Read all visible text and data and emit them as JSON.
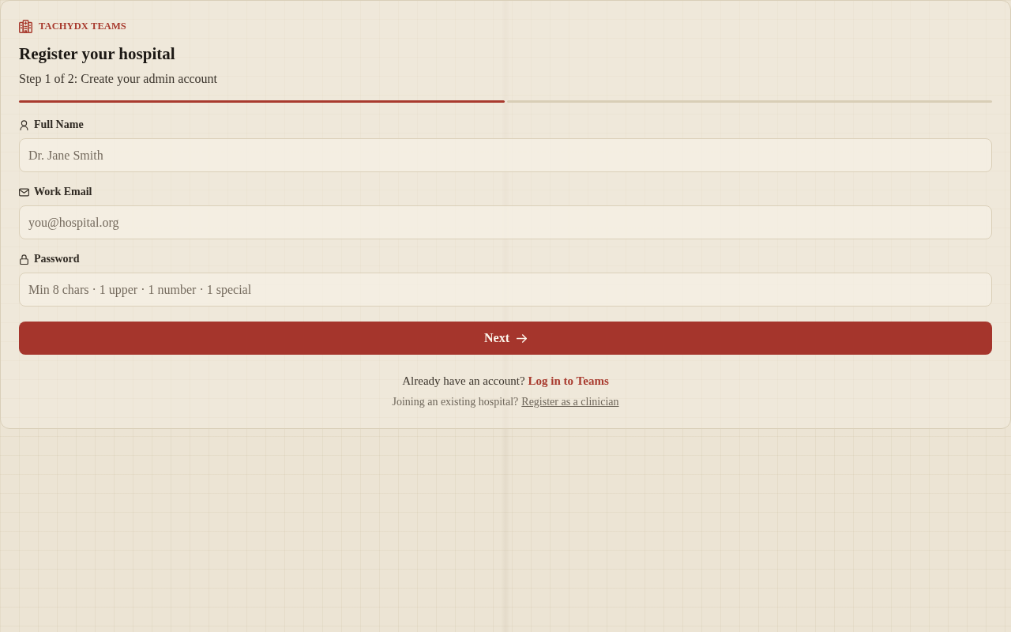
{
  "brand": {
    "name": "TACHYDX TEAMS"
  },
  "title": "Register your hospital",
  "subtitle": "Step 1 of 2: Create your admin account",
  "progress": {
    "steps": [
      {
        "complete": true
      },
      {
        "complete": false
      }
    ]
  },
  "fields": [
    {
      "kind": "name",
      "label": "Full Name",
      "placeholder": "Dr. Jane Smith"
    },
    {
      "kind": "email",
      "label": "Work Email",
      "placeholder": "you@hospital.org"
    },
    {
      "kind": "password",
      "label": "Password",
      "placeholder": "Min 8 chars · 1 upper · 1 number · 1 special"
    }
  ],
  "submit_button": {
    "label": "Next"
  },
  "footer_links": [
    {
      "kind": "primary",
      "prompt": "Already have an account?",
      "link": "Log in to Teams"
    },
    {
      "kind": "secondary",
      "prompt": "Joining an existing hospital?",
      "link": "Register as a clinician"
    }
  ]
}
